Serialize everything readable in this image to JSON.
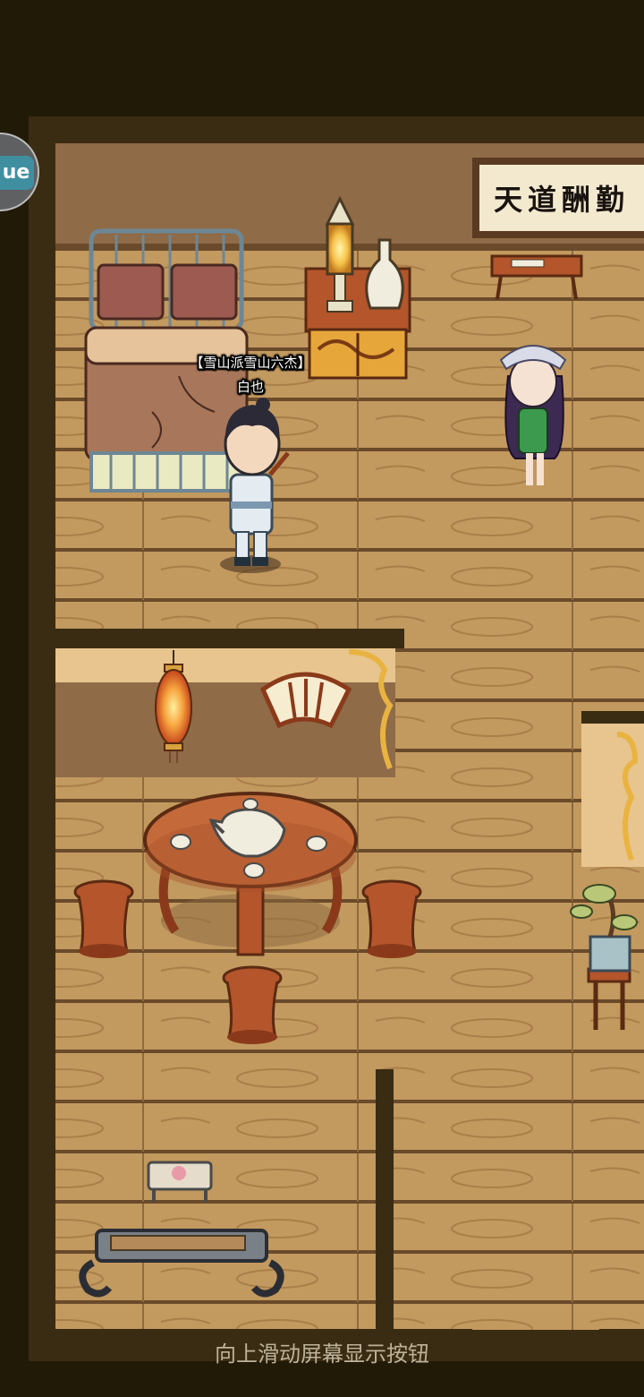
{
  "plaque": {
    "text": "天道酬勤"
  },
  "player": {
    "title": "【雪山派雪山六杰】",
    "name": "白也"
  },
  "side_button": {
    "label": "ue"
  },
  "hint": {
    "text": "向上滑动屏幕显示按钮"
  },
  "colors": {
    "floor": "#c2995f",
    "plank_line": "#6a4a2a",
    "wall": "#3a2c12",
    "background": "#211a07",
    "wood_red": "#b4552c",
    "lantern": "#f39a3a"
  },
  "icons": [
    "bed",
    "lamp",
    "vase",
    "cabinet",
    "desk",
    "lantern",
    "fan-window",
    "teapot",
    "tea-cup",
    "round-table",
    "stool",
    "bonsai",
    "pedestal",
    "footstool",
    "guqin-table"
  ]
}
